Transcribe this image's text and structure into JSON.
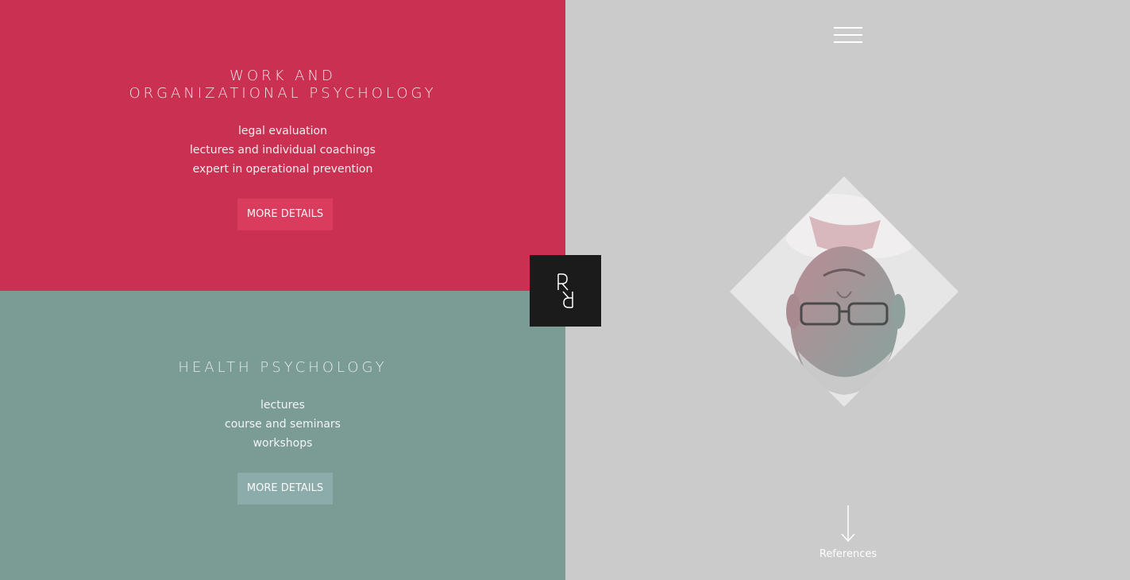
{
  "work": {
    "heading_line1": "WORK AND",
    "heading_line2": "ORGANIZATIONAL PSYCHOLOGY",
    "items": [
      "legal evaluation",
      "lectures and individual coachings",
      "expert in operational prevention"
    ],
    "button": "MORE DETAILS",
    "color": "#c93051"
  },
  "health": {
    "heading": "HEALTH PSYCHOLOGY",
    "items": [
      "lectures",
      "course and seminars",
      "workshops"
    ],
    "button": "MORE DETAILS",
    "color": "#7b9c95"
  },
  "logo": {
    "icon": "rr-monogram-logo"
  },
  "menu": {
    "icon": "hamburger-menu-icon"
  },
  "portrait": {
    "description_icon": "portrait-photo"
  },
  "references": {
    "label": "References",
    "icon": "arrow-down-icon"
  },
  "colors": {
    "right_bg": "#cbcbcb",
    "logo_bg": "#1b1b1b"
  }
}
